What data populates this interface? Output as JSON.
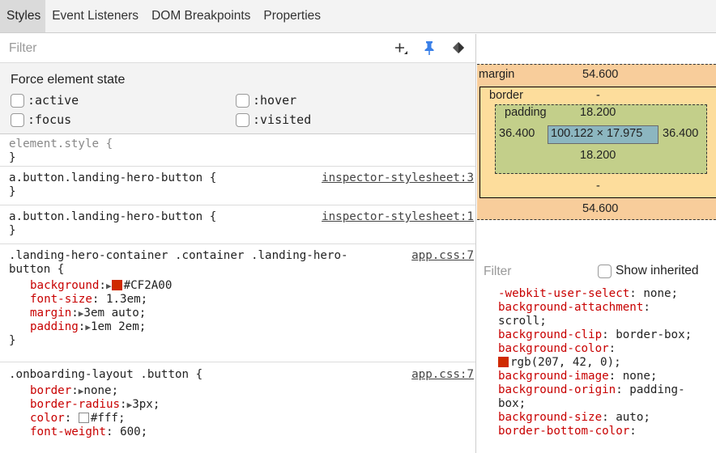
{
  "tabs": [
    "Styles",
    "Event Listeners",
    "DOM Breakpoints",
    "Properties"
  ],
  "styles_filter": {
    "placeholder": "Filter"
  },
  "toolbar_icons": [
    "plus-icon",
    "pin-icon",
    "diamond-toggle-icon"
  ],
  "force_state": {
    "title": "Force element state",
    "options": [
      ":active",
      ":hover",
      ":focus",
      ":visited"
    ]
  },
  "rules": {
    "element_style": {
      "selector": "element.style {",
      "close": "}"
    },
    "r1": {
      "selector": "a.button.landing-hero-button {",
      "source": "inspector-stylesheet:3",
      "close": "}"
    },
    "r2": {
      "selector": "a.button.landing-hero-button {",
      "source": "inspector-stylesheet:1",
      "close": "}"
    },
    "r3": {
      "selector_line1": ".landing-hero-container .container .landing-hero-",
      "selector_line2": "button {",
      "source": "app.css:7",
      "decls": [
        {
          "name": "background",
          "value": "#CF2A00"
        },
        {
          "name": "font-size",
          "value": "1.3em;"
        },
        {
          "name": "margin",
          "value": "3em auto;"
        },
        {
          "name": "padding",
          "value": "1em 2em;"
        }
      ],
      "close": "}"
    },
    "r4": {
      "selector": ".onboarding-layout .button {",
      "source": "app.css:7",
      "decls": [
        {
          "name": "border",
          "value": "none;"
        },
        {
          "name": "border-radius",
          "value": "3px;"
        },
        {
          "name": "color",
          "value": "#fff;"
        },
        {
          "name": "font-weight",
          "value": "600;"
        }
      ]
    }
  },
  "colors": {
    "background_swatch": "#CF2A00",
    "color_swatch": "#ffffff"
  },
  "box_model": {
    "margin_label": "margin",
    "margin_top": "54.600",
    "margin_bottom": "54.600",
    "margin_left": "-",
    "margin_right": "-",
    "border_label": "border",
    "border_top": "-",
    "border_bottom": "-",
    "padding_label": "padding",
    "padding_top": "18.200",
    "padding_bottom": "18.200",
    "padding_left": "36.400",
    "padding_right": "36.400",
    "content": "100.122 × 17.975"
  },
  "computed_filter": {
    "placeholder": "Filter",
    "show_inherited": "Show inherited"
  },
  "computed": [
    [
      "-webkit-user-select",
      ": none;"
    ],
    [
      "background-attachment",
      ":"
    ],
    [
      "",
      "scroll;"
    ],
    [
      "background-clip",
      ": border-box;"
    ],
    [
      "background-color",
      ":"
    ],
    [
      "",
      "rgb(207, 42, 0);"
    ],
    [
      "background-image",
      ": none;"
    ],
    [
      "background-origin",
      ": padding-"
    ],
    [
      "",
      "box;"
    ],
    [
      "background-size",
      ": auto;"
    ],
    [
      "border-bottom-color",
      ":"
    ]
  ]
}
